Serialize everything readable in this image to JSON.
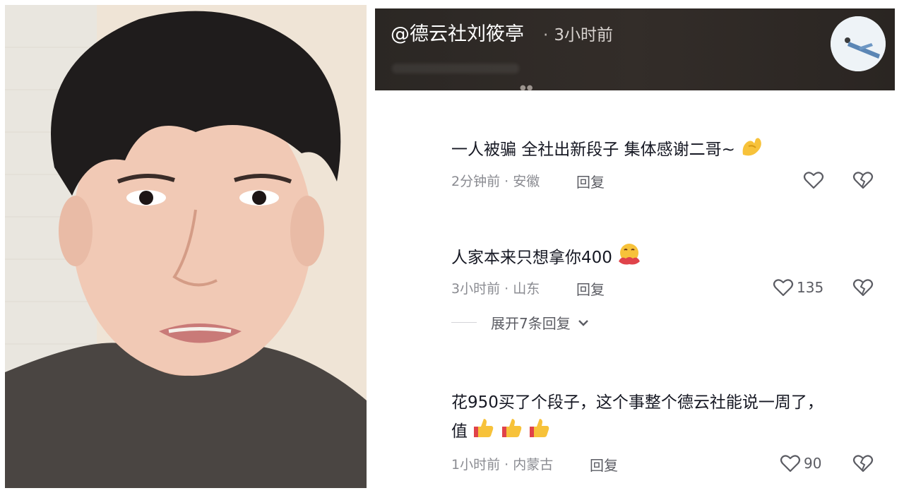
{
  "post": {
    "username": "@德云社刘筱亭",
    "time": "3小时前"
  },
  "comments": [
    {
      "text": "一人被骗  全社出新段子 集体感谢二哥~",
      "emojis": [
        "pinch-hand-emoji"
      ],
      "meta": "2分钟前 · 安徽",
      "reply": "回复",
      "likes": ""
    },
    {
      "text": "人家本来只想拿你400",
      "emojis": [
        "hugging-face-emoji"
      ],
      "meta": "3小时前 · 山东",
      "reply": "回复",
      "likes": "135",
      "expand_label": "展开7条回复"
    },
    {
      "text_line1": "花950买了个段子，这个事整个德云社能说一周了，",
      "text_line2": "值",
      "emojis": [
        "thumbs-up-emoji",
        "thumbs-up-emoji",
        "thumbs-up-emoji"
      ],
      "meta": "1小时前 · 内蒙古",
      "reply": "回复",
      "likes": "90"
    }
  ],
  "colors": {
    "header_bg": "#2b2724",
    "text_primary": "#161823",
    "text_secondary": "#8a8b91",
    "icon": "#5b5c63"
  }
}
